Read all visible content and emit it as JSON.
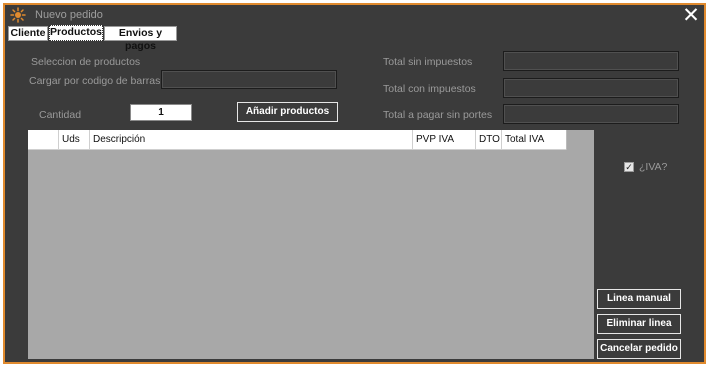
{
  "window": {
    "title": "Nuevo pedido",
    "close_symbol": "✕",
    "accent_color": "#e08a2e",
    "app_icon": "sun-logo-icon"
  },
  "tabs": [
    {
      "label": "Cliente",
      "active": false
    },
    {
      "label": "Productos",
      "active": true
    },
    {
      "label": "Envios y pagos",
      "active": false
    }
  ],
  "products": {
    "section_label": "Seleccion de productos",
    "barcode_label": "Cargar por codigo de barras",
    "barcode_value": "",
    "quantity_label": "Cantidad",
    "quantity_value": "1",
    "add_button": "Añadir productos"
  },
  "totals": {
    "without_tax_label": "Total sin impuestos",
    "without_tax_value": "",
    "with_tax_label": "Total con impuestos",
    "with_tax_value": "",
    "no_shipping_label": "Total a pagar sin portes",
    "no_shipping_value": ""
  },
  "table": {
    "columns": [
      "",
      "Uds",
      "Descripción",
      "PVP IVA",
      "DTO",
      "Total IVA"
    ],
    "rows": []
  },
  "iva_checkbox": {
    "label": "¿IVA?",
    "checked": true
  },
  "actions": {
    "manual_line": "Linea manual",
    "delete_line": "Eliminar linea",
    "cancel_order": "Cancelar pedido"
  }
}
